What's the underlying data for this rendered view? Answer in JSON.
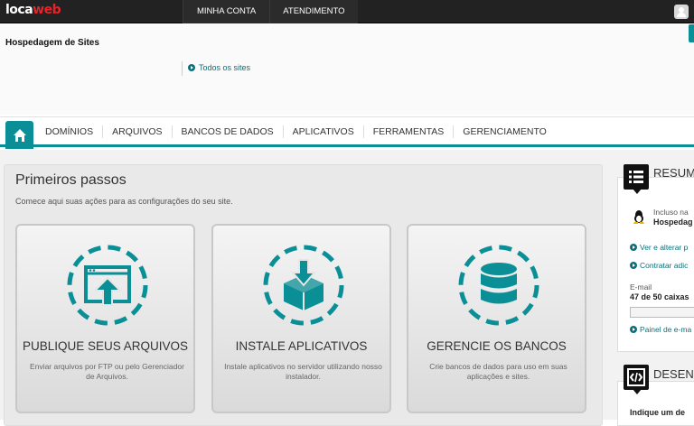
{
  "topbar": {
    "logo_a": "loca",
    "logo_b": "web",
    "nav": [
      "MINHA CONTA",
      "ATENDIMENTO"
    ]
  },
  "header": {
    "site_title": "Hospedagem de Sites",
    "all_sites": "Todos os sites"
  },
  "nav": {
    "items": [
      "DOMÍNIOS",
      "ARQUIVOS",
      "BANCOS DE DADOS",
      "APLICATIVOS",
      "FERRAMENTAS",
      "GERENCIAMENTO"
    ]
  },
  "main": {
    "title": "Primeiros passos",
    "subtitle": "Comece aqui suas ações para as configurações do seu site.",
    "cards": [
      {
        "title": "PUBLIQUE SEUS ARQUIVOS",
        "desc": "Enviar arquivos por FTP ou pelo Gerenciador de Arquivos.",
        "icon": "upload-icon"
      },
      {
        "title": "INSTALE APLICATIVOS",
        "desc": "Instale aplicativos no servidor utilizando nosso instalador.",
        "icon": "install-box-icon"
      },
      {
        "title": "GERENCIE OS BANCOS",
        "desc": "Crie bancos de dados para uso em suas aplicações e sites.",
        "icon": "database-icon"
      }
    ]
  },
  "sidebar": {
    "resumo_title": "RESUMO",
    "incluso": "Incluso na",
    "hospedag": "Hospedag",
    "link1": "Ver e alterar p",
    "link2": "Contratar adic",
    "email_label": "E-mail",
    "email_count": "47 de 50 caixas",
    "painel": "Painel de e-ma",
    "dev_title": "DESENV",
    "indique": "Indique um de"
  },
  "colors": {
    "accent": "#0a8f96",
    "brand_red": "#e8232a"
  }
}
